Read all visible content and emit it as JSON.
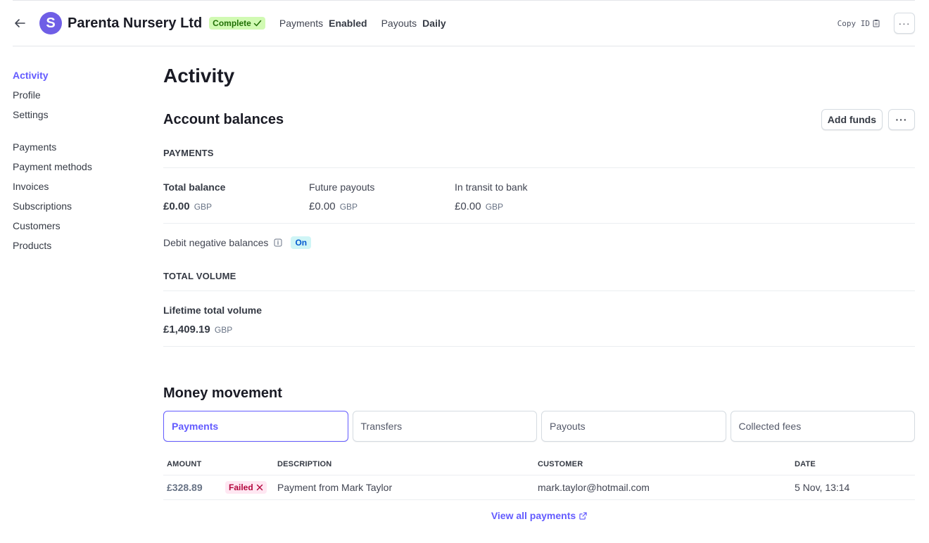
{
  "header": {
    "avatar_letter": "S",
    "account_name": "Parenta Nursery Ltd",
    "status_badge": "Complete",
    "payments_label": "Payments",
    "payments_value": "Enabled",
    "payouts_label": "Payouts",
    "payouts_value": "Daily",
    "copy_id_label": "Copy ID",
    "more_label": "···"
  },
  "sidebar": {
    "items": [
      {
        "label": "Activity",
        "active": true
      },
      {
        "label": "Profile"
      },
      {
        "label": "Settings"
      },
      {
        "label": "Payments"
      },
      {
        "label": "Payment methods"
      },
      {
        "label": "Invoices"
      },
      {
        "label": "Subscriptions"
      },
      {
        "label": "Customers"
      },
      {
        "label": "Products"
      }
    ]
  },
  "main": {
    "title": "Activity",
    "balances": {
      "title": "Account balances",
      "add_funds_label": "Add funds",
      "more_label": "···",
      "payments_caption": "PAYMENTS",
      "total_balance_label": "Total balance",
      "total_balance_value": "£0.00",
      "total_balance_currency": "GBP",
      "future_payouts_label": "Future payouts",
      "future_payouts_value": "£0.00",
      "future_payouts_currency": "GBP",
      "in_transit_label": "In transit to bank",
      "in_transit_value": "£0.00",
      "in_transit_currency": "GBP",
      "debit_label": "Debit negative balances",
      "debit_status": "On",
      "volume_caption": "TOTAL VOLUME",
      "lifetime_label": "Lifetime total volume",
      "lifetime_value": "£1,409.19",
      "lifetime_currency": "GBP"
    },
    "money_movement": {
      "title": "Money movement",
      "tabs": [
        {
          "label": "Payments",
          "active": true
        },
        {
          "label": "Transfers"
        },
        {
          "label": "Payouts"
        },
        {
          "label": "Collected fees"
        }
      ],
      "columns": {
        "amount": "AMOUNT",
        "description": "DESCRIPTION",
        "customer": "CUSTOMER",
        "date": "DATE"
      },
      "rows": [
        {
          "amount": "£328.89",
          "status": "Failed",
          "description": "Payment from Mark Taylor",
          "customer": "mark.taylor@hotmail.com",
          "date": "5 Nov, 13:14"
        }
      ],
      "view_all_label": "View all payments"
    }
  },
  "colors": {
    "accent": "#635bff",
    "avatar": "#6f5ee6",
    "complete_bg": "#d1fab3",
    "failed_bg": "#ffe7f2",
    "on_bg": "#cff5f6"
  }
}
